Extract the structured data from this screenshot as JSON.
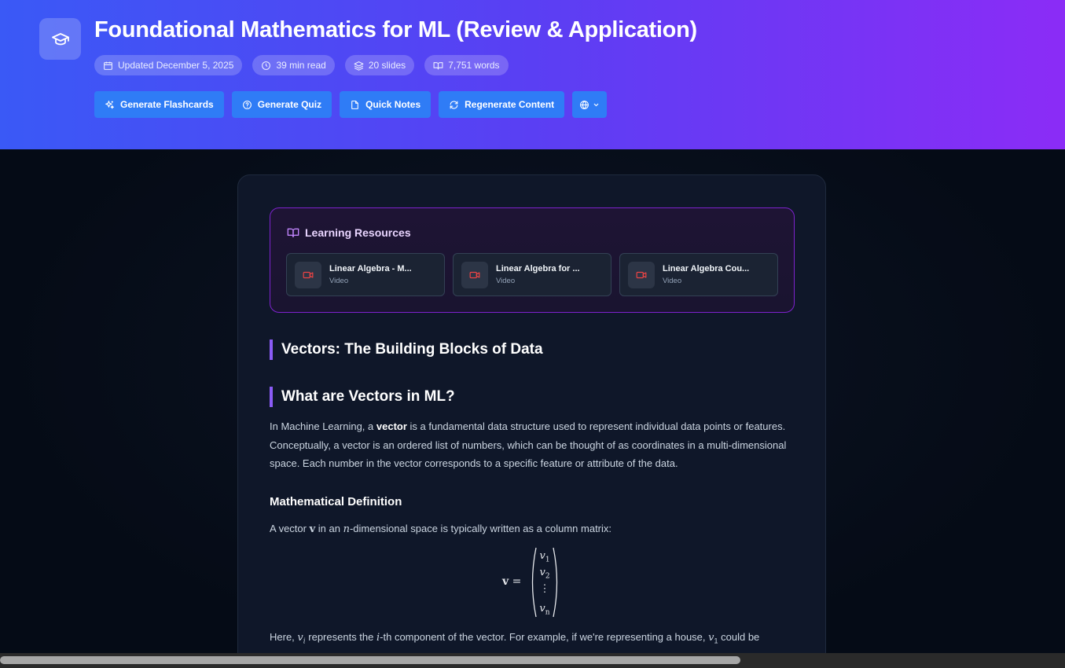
{
  "header": {
    "title": "Foundational Mathematics for ML (Review & Application)",
    "meta": [
      {
        "icon": "calendar-icon",
        "text": "Updated December 5, 2025"
      },
      {
        "icon": "clock-icon",
        "text": "39 min read"
      },
      {
        "icon": "layers-icon",
        "text": "20 slides"
      },
      {
        "icon": "book-icon",
        "text": "7,751 words"
      }
    ],
    "buttons": {
      "flashcards": "Generate Flashcards",
      "quiz": "Generate Quiz",
      "notes": "Quick Notes",
      "regenerate": "Regenerate Content"
    }
  },
  "resources": {
    "title": "Learning Resources",
    "items": [
      {
        "name": "Linear Algebra - M...",
        "type": "Video"
      },
      {
        "name": "Linear Algebra for ...",
        "type": "Video"
      },
      {
        "name": "Linear Algebra Cou...",
        "type": "Video"
      }
    ]
  },
  "content": {
    "section_title": "Vectors: The Building Blocks of Data",
    "subsection_title": "What are Vectors in ML?",
    "intro_pre": "In Machine Learning, a ",
    "intro_bold": "vector",
    "intro_post": " is a fundamental data structure used to represent individual data points or features. Conceptually, a vector is an ordered list of numbers, which can be thought of as coordinates in a multi-dimensional space. Each number in the vector corresponds to a specific feature or attribute of the data.",
    "def_title": "Mathematical Definition",
    "def_pre": "A vector ",
    "def_var": "v",
    "def_mid": " in an ",
    "def_n": "n",
    "def_post": "-dimensional space is typically written as a column matrix:",
    "matrix_lhs": "v",
    "matrix_eq": " =",
    "matrix_entries": [
      "v",
      "v",
      "⋮",
      "v"
    ],
    "matrix_subs": [
      "1",
      "2",
      "",
      "n"
    ],
    "here_pre": "Here, ",
    "here_var": "v",
    "here_sub": "i",
    "here_mid": " represents the ",
    "here_i": "i",
    "here_post": "-th component of the vector. For example, if we're representing a house, ",
    "here_var2": "v",
    "here_sub2": "1",
    "here_end": " could be"
  },
  "colors": {
    "accent": "#2f7cf6",
    "header_gradient_start": "#3a59f6",
    "header_gradient_end": "#8b2cf6",
    "heading_bar": "#8b5cf6",
    "resource_border": "#7e22ce",
    "video_icon": "#ef4444"
  }
}
